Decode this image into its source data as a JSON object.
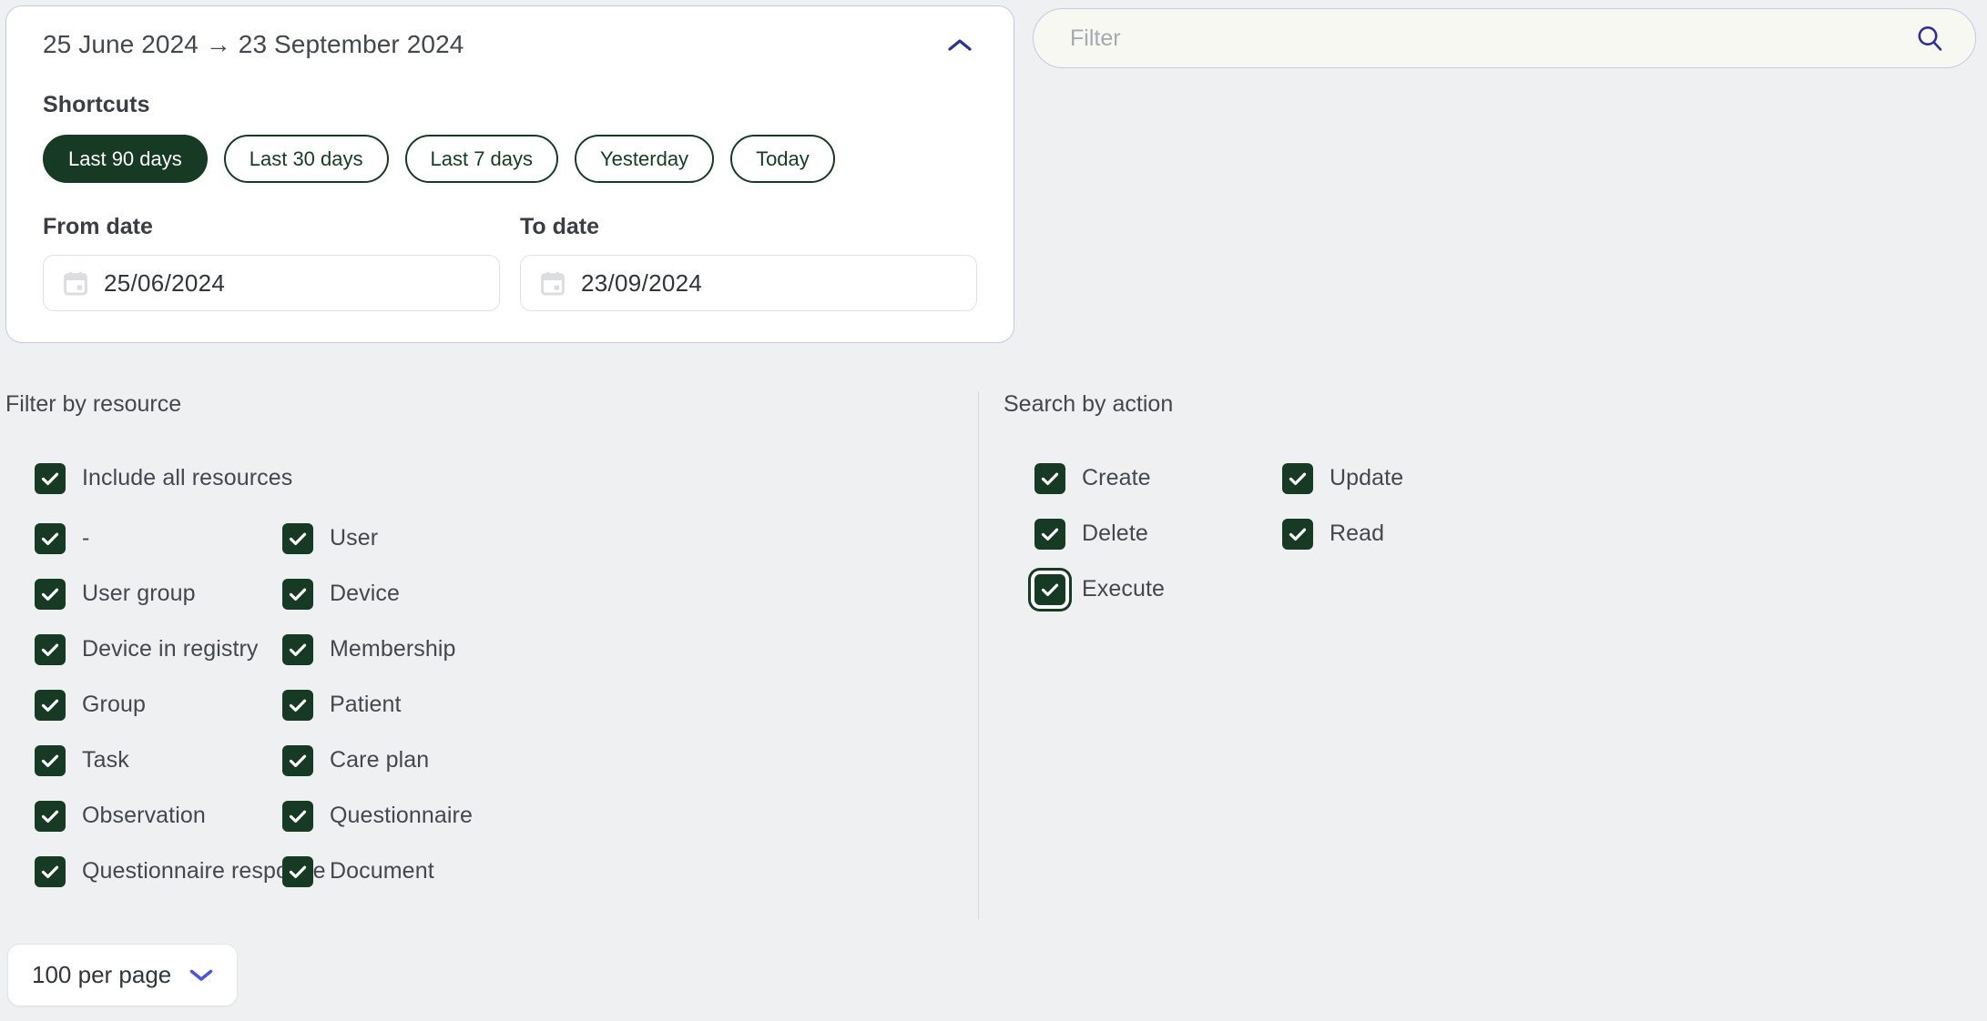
{
  "date_card": {
    "range_label": "25 June 2024 → 23 September 2024",
    "collapse_icon": "chevron-up-icon",
    "shortcuts_label": "Shortcuts",
    "shortcuts": [
      {
        "label": "Last 90 days",
        "active": true
      },
      {
        "label": "Last 30 days",
        "active": false
      },
      {
        "label": "Last 7 days",
        "active": false
      },
      {
        "label": "Yesterday",
        "active": false
      },
      {
        "label": "Today",
        "active": false
      }
    ],
    "from": {
      "label": "From date",
      "value": "25/06/2024",
      "icon": "calendar-icon"
    },
    "to": {
      "label": "To date",
      "value": "23/09/2024",
      "icon": "calendar-icon"
    }
  },
  "filter_search": {
    "placeholder": "Filter",
    "value": "",
    "icon": "search-icon"
  },
  "resource_panel": {
    "title": "Filter by resource",
    "include_all": {
      "label": "Include all resources",
      "checked": true
    },
    "items_left": [
      {
        "label": "-",
        "checked": true
      },
      {
        "label": "User group",
        "checked": true
      },
      {
        "label": "Device in registry",
        "checked": true
      },
      {
        "label": "Group",
        "checked": true
      },
      {
        "label": "Task",
        "checked": true
      },
      {
        "label": "Observation",
        "checked": true
      },
      {
        "label": "Questionnaire response",
        "checked": true
      }
    ],
    "items_right": [
      {
        "label": "User",
        "checked": true
      },
      {
        "label": "Device",
        "checked": true
      },
      {
        "label": "Membership",
        "checked": true
      },
      {
        "label": "Patient",
        "checked": true
      },
      {
        "label": "Care plan",
        "checked": true
      },
      {
        "label": "Questionnaire",
        "checked": true
      },
      {
        "label": "Document",
        "checked": true
      }
    ]
  },
  "action_panel": {
    "title": "Search by action",
    "items_left": [
      {
        "label": "Create",
        "checked": true,
        "focused": false
      },
      {
        "label": "Delete",
        "checked": true,
        "focused": false
      },
      {
        "label": "Execute",
        "checked": true,
        "focused": true
      }
    ],
    "items_right": [
      {
        "label": "Update",
        "checked": true,
        "focused": false
      },
      {
        "label": "Read",
        "checked": true,
        "focused": false
      }
    ]
  },
  "footer": {
    "per_page_label": "100 per page",
    "per_page_icon": "chevron-down-icon"
  },
  "colors": {
    "accent_green": "#173a25",
    "page_bg": "#eff0f2",
    "card_border": "#c6c9e0",
    "search_bg": "#f7f8f1",
    "chevron_indigo": "#2e3090",
    "chevron_blue": "#4b56d6",
    "text": "#43474e"
  }
}
